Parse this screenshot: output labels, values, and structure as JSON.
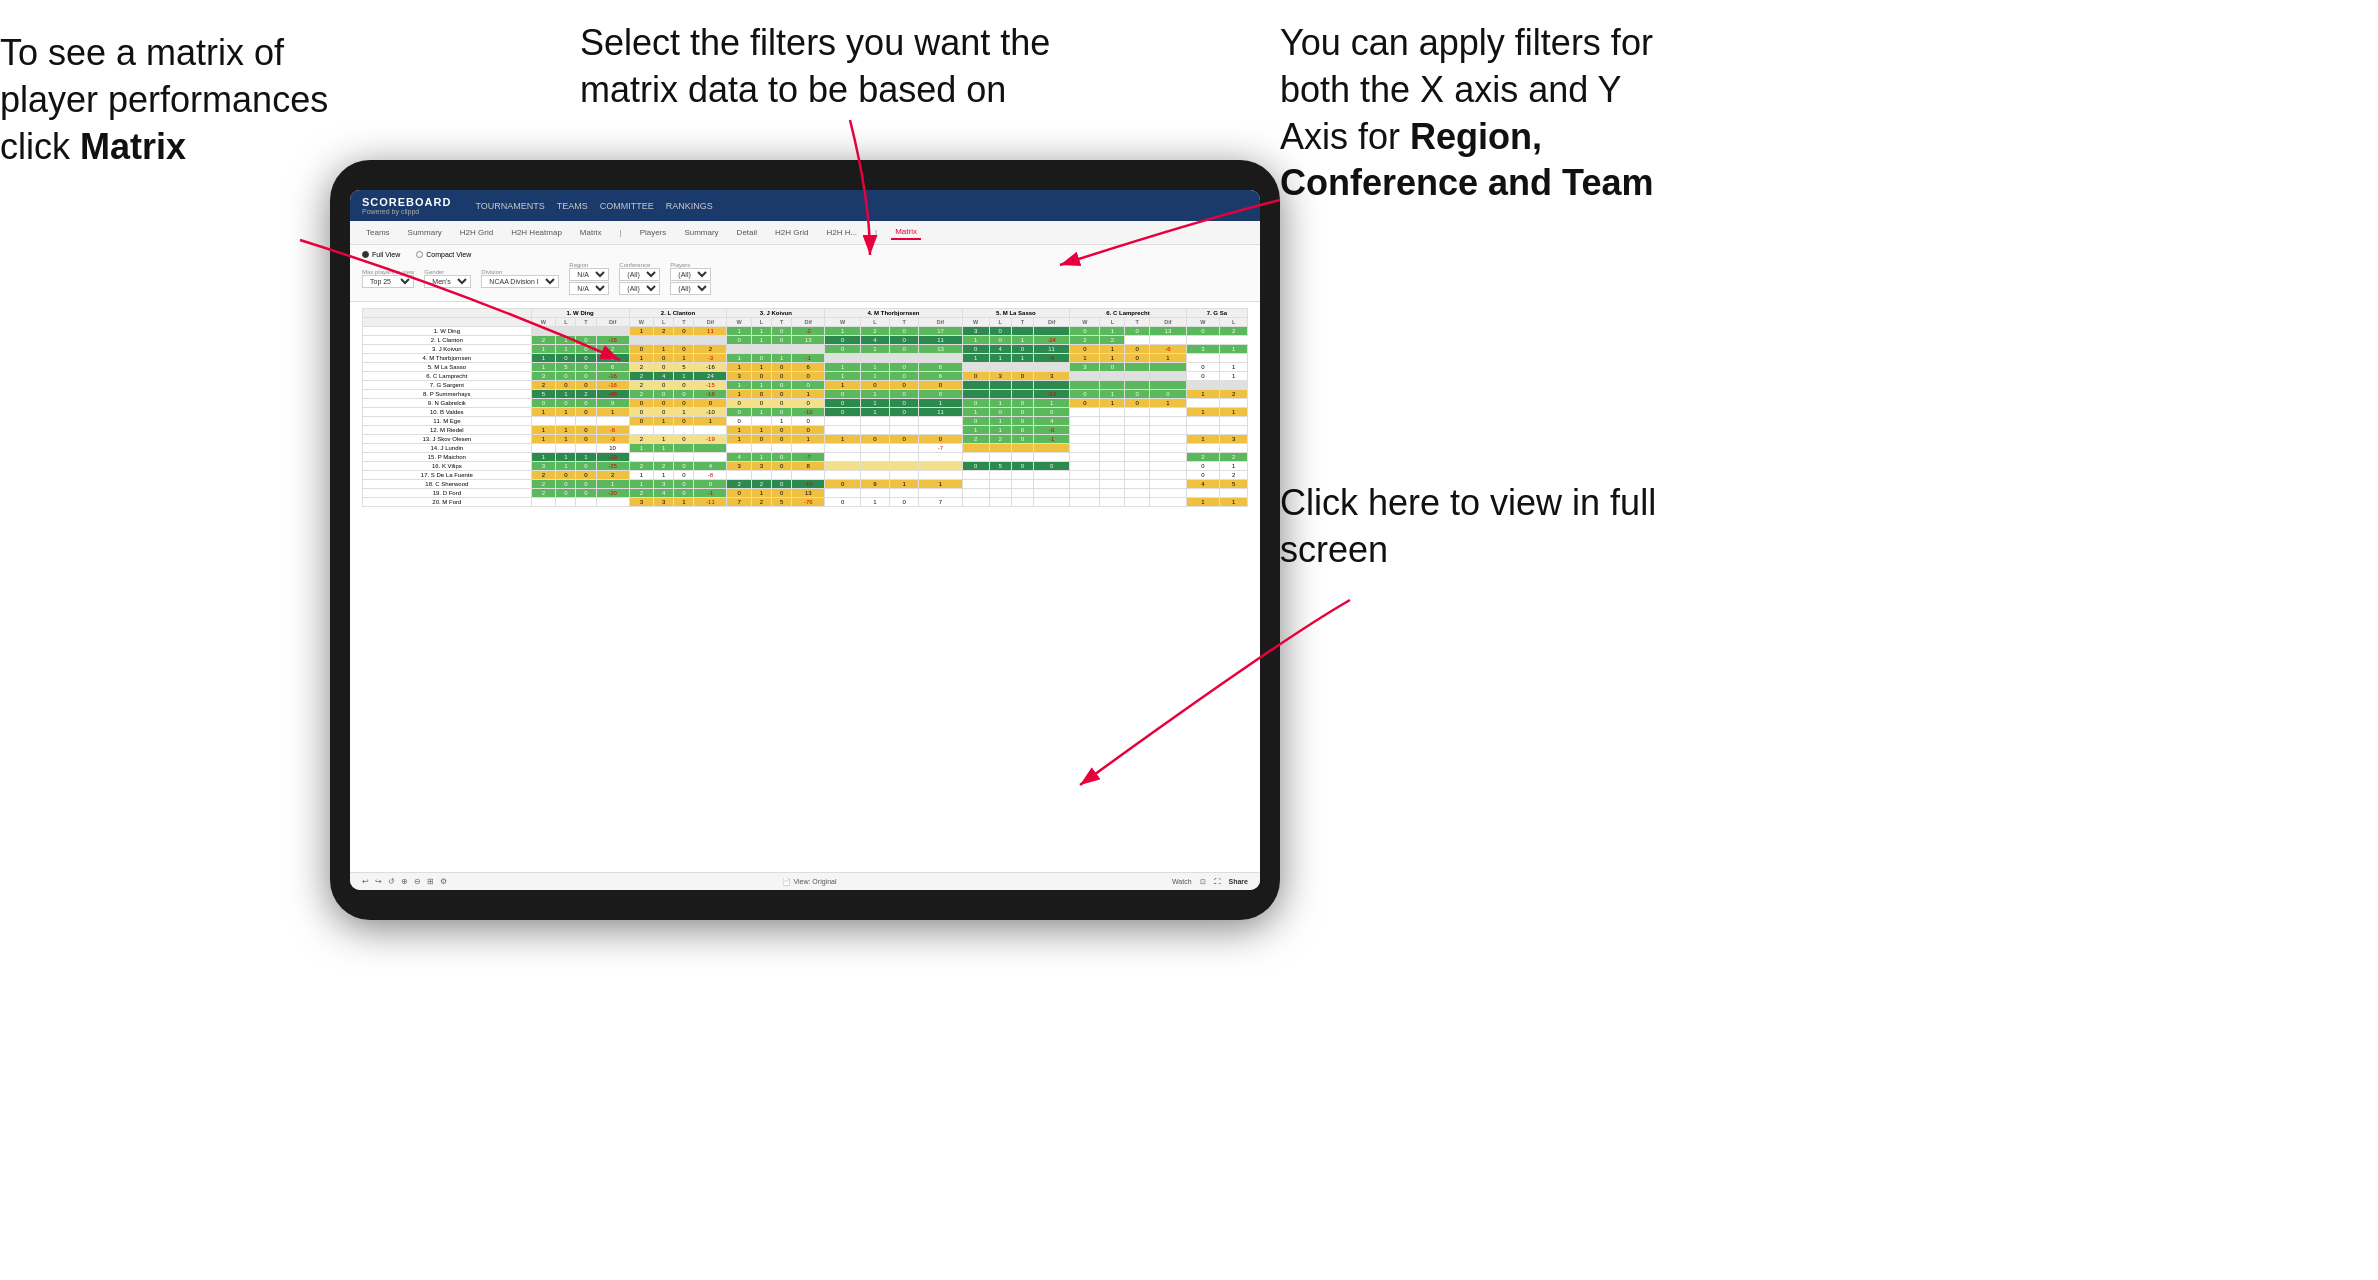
{
  "annotations": {
    "matrix_text": "To see a matrix of player performances click ",
    "matrix_bold": "Matrix",
    "filters_text": "Select the filters you want the matrix data to be based on",
    "axes_text": "You  can apply filters for both the X axis and Y Axis for ",
    "axes_bold": "Region, Conference and Team",
    "fullscreen_text": "Click here to view in full screen"
  },
  "tablet": {
    "nav": {
      "logo": "SCOREBOARD",
      "logo_sub": "Powered by clippd",
      "items": [
        "TOURNAMENTS",
        "TEAMS",
        "COMMITTEE",
        "RANKINGS"
      ]
    },
    "sub_nav": {
      "items": [
        "Teams",
        "Summary",
        "H2H Grid",
        "H2H Heatmap",
        "Matrix",
        "Players",
        "Summary",
        "Detail",
        "H2H Grid",
        "H2H H...",
        "Matrix"
      ],
      "active": "Matrix"
    },
    "filters": {
      "view_options": [
        "Full View",
        "Compact View"
      ],
      "active_view": "Full View",
      "filters": [
        {
          "label": "Max players in view",
          "value": "Top 25"
        },
        {
          "label": "Gender",
          "value": "Men's"
        },
        {
          "label": "Division",
          "value": "NCAA Division I"
        },
        {
          "label": "Region",
          "value": "N/A",
          "value2": "N/A"
        },
        {
          "label": "Conference",
          "value": "(All)",
          "value2": "(All)"
        },
        {
          "label": "Players",
          "value": "(All)",
          "value2": "(All)"
        }
      ]
    },
    "matrix": {
      "col_headers": [
        "1. W Ding",
        "2. L Clanton",
        "3. J Koivun",
        "4. M Thorbjornsen",
        "5. M La Sasso",
        "6. C Lamprecht",
        "7. G Sa"
      ],
      "sub_cols": [
        "W",
        "L",
        "T",
        "Dif"
      ],
      "rows": [
        {
          "name": "1. W Ding",
          "data": []
        },
        {
          "name": "2. L Clanton",
          "data": []
        },
        {
          "name": "3. J Koivun",
          "data": []
        },
        {
          "name": "4. M Thorbjornsen",
          "data": []
        },
        {
          "name": "5. M La Sasso",
          "data": []
        },
        {
          "name": "6. C Lamprecht",
          "data": []
        },
        {
          "name": "7. G Sargent",
          "data": []
        },
        {
          "name": "8. P Summerhays",
          "data": []
        },
        {
          "name": "9. N Gabrelcik",
          "data": []
        },
        {
          "name": "10. B Valdes",
          "data": []
        },
        {
          "name": "11. M Ege",
          "data": []
        },
        {
          "name": "12. M Riedel",
          "data": []
        },
        {
          "name": "13. J Skov Olesen",
          "data": []
        },
        {
          "name": "14. J Lundin",
          "data": []
        },
        {
          "name": "15. P Maichon",
          "data": []
        },
        {
          "name": "16. K Vilips",
          "data": []
        },
        {
          "name": "17. S De La Fuente",
          "data": []
        },
        {
          "name": "18. C Sherwood",
          "data": []
        },
        {
          "name": "19. D Ford",
          "data": []
        },
        {
          "name": "20. M Ford",
          "data": []
        }
      ]
    },
    "bottom_bar": {
      "view_label": "View: Original",
      "watch_label": "Watch",
      "share_label": "Share"
    }
  }
}
